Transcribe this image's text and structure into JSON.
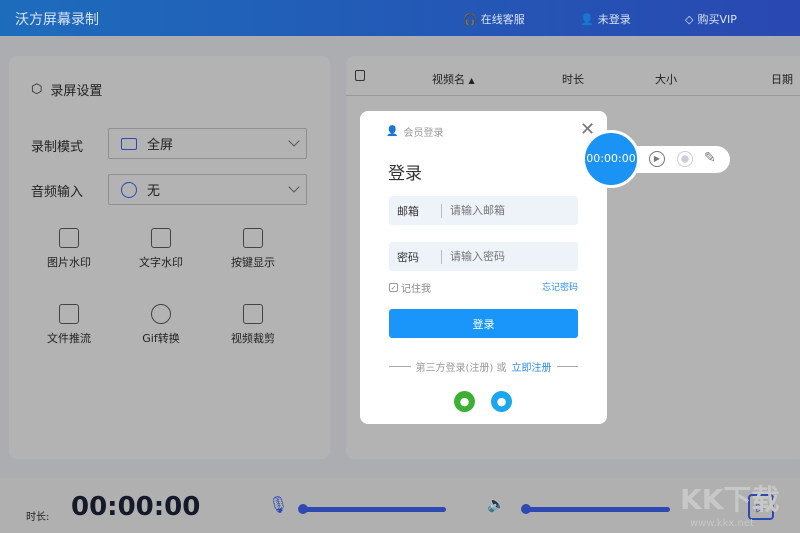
{
  "header": {
    "title": "沃方屏幕录制",
    "nav": [
      {
        "icon": "headset-icon",
        "label": "在线客服"
      },
      {
        "icon": "user-icon",
        "label": "未登录"
      },
      {
        "icon": "diamond-icon",
        "label": "购买VIP"
      }
    ]
  },
  "settings": {
    "title": "录屏设置",
    "mode_label": "录制模式",
    "mode_value": "全屏",
    "audio_label": "音频输入",
    "audio_value": "无",
    "tools": [
      "图片水印",
      "文字水印",
      "按键显示",
      "文件推流",
      "Gif转换",
      "视频裁剪"
    ]
  },
  "table": {
    "columns": [
      "视频名",
      "时长",
      "大小",
      "日期"
    ]
  },
  "bottom": {
    "duration_label": "时长:",
    "duration": "00:00:00",
    "mic_level": 0,
    "speaker_level": 0
  },
  "login": {
    "header": "会员登录",
    "title": "登录",
    "email_label": "邮箱",
    "email_placeholder": "请输入邮箱",
    "password_label": "密码",
    "password_placeholder": "请输入密码",
    "remember": "记住我",
    "forgot": "忘记密码",
    "submit": "登录",
    "third_party": "第三方登录(注册) 或",
    "register": "立即注册"
  },
  "recorder": {
    "time": "00:00:00"
  },
  "watermark": {
    "text": "KK下载",
    "url": "www.kkx.net"
  }
}
